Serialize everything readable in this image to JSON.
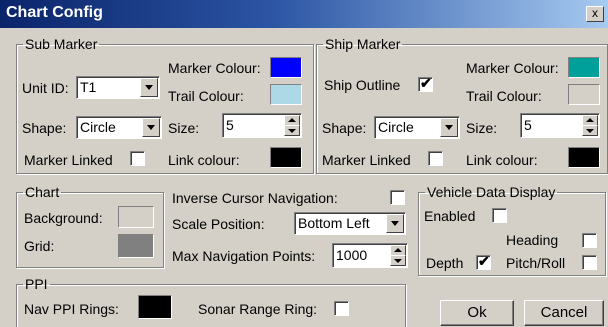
{
  "window": {
    "title": "Chart Config",
    "close_glyph": "x"
  },
  "sub_marker": {
    "legend": "Sub Marker",
    "unit_id_label": "Unit ID:",
    "unit_id_value": "T1",
    "marker_colour_label": "Marker Colour:",
    "marker_colour": "#0000ff",
    "trail_colour_label": "Trail Colour:",
    "trail_colour": "#add8e6",
    "shape_label": "Shape:",
    "shape_value": "Circle",
    "size_label": "Size:",
    "size_value": "5",
    "marker_linked_label": "Marker Linked",
    "marker_linked": false,
    "link_colour_label": "Link colour:",
    "link_colour": "#000000"
  },
  "ship_marker": {
    "legend": "Ship Marker",
    "ship_outline_label": "Ship Outline",
    "ship_outline": true,
    "marker_colour_label": "Marker Colour:",
    "marker_colour": "#00a09a",
    "trail_colour_label": "Trail Colour:",
    "trail_colour": "#d4d0c8",
    "shape_label": "Shape:",
    "shape_value": "Circle",
    "size_label": "Size:",
    "size_value": "5",
    "marker_linked_label": "Marker Linked",
    "marker_linked": false,
    "link_colour_label": "Link colour:",
    "link_colour": "#000000"
  },
  "chart": {
    "legend": "Chart",
    "background_label": "Background:",
    "background_colour": "#d4d0c8",
    "grid_label": "Grid:",
    "grid_colour": "#808080"
  },
  "navigation": {
    "inverse_cursor_label": "Inverse Cursor Navigation:",
    "inverse_cursor": false,
    "scale_position_label": "Scale Position:",
    "scale_position_value": "Bottom Left",
    "max_points_label": "Max Navigation Points:",
    "max_points_value": "1000"
  },
  "vehicle": {
    "legend": "Vehicle Data Display",
    "enabled_label": "Enabled",
    "enabled": false,
    "heading_label": "Heading",
    "heading": false,
    "depth_label": "Depth",
    "depth": true,
    "pitch_roll_label": "Pitch/Roll",
    "pitch_roll": false
  },
  "ppi": {
    "legend": "PPI",
    "nav_rings_label": "Nav PPI Rings:",
    "nav_rings_colour": "#000000",
    "sonar_ring_label": "Sonar Range Ring:",
    "sonar_ring": false
  },
  "buttons": {
    "ok": "Ok",
    "cancel": "Cancel"
  },
  "tick_glyph": "✔"
}
